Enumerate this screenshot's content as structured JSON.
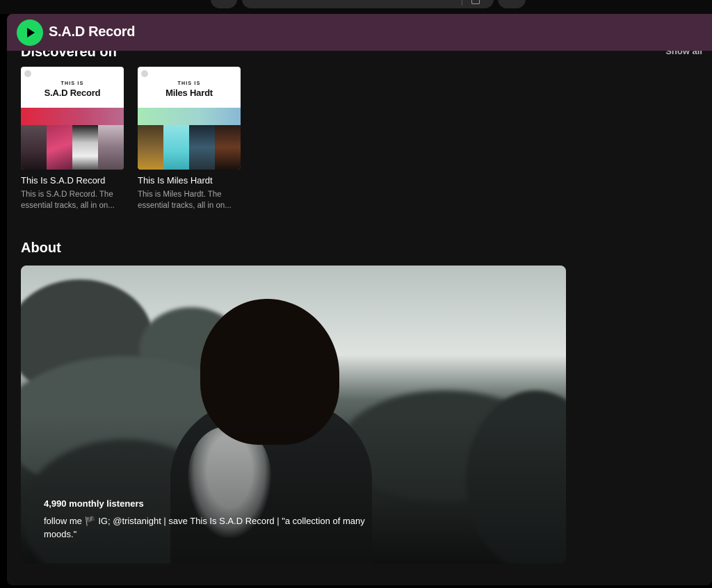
{
  "header": {
    "artist_name": "S.A.D Record",
    "play_icon": "play-icon",
    "accent_color": "#1ed760",
    "bar_color": "#48283f"
  },
  "discovered_on": {
    "heading": "Discovered on",
    "show_all_label": "Show all",
    "cards": [
      {
        "cover_kicker": "THIS IS",
        "cover_name": "S.A.D Record",
        "title": "This Is S.A.D Record",
        "description": "This is S.A.D Record. The essential tracks, all in on..."
      },
      {
        "cover_kicker": "THIS IS",
        "cover_name": "Miles Hardt",
        "title": "This Is Miles Hardt",
        "description": "This is Miles Hardt. The essential tracks, all in on..."
      }
    ]
  },
  "about": {
    "heading": "About",
    "monthly_listeners": "4,990 monthly listeners",
    "bio": "follow me 🏴 IG; @tristanight | save This Is S.A.D Record | \"a collection of many moods.\""
  }
}
